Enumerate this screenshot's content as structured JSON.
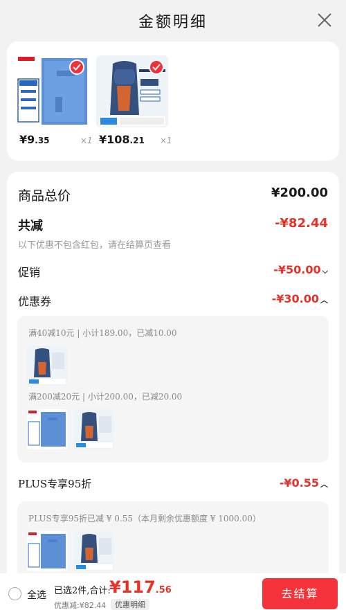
{
  "header": {
    "title": "金额明细"
  },
  "products": [
    {
      "price_int": "¥9",
      "price_dec": ".35",
      "qty": "×1",
      "image": "blue-file-box"
    },
    {
      "price_int": "¥108",
      "price_dec": ".21",
      "qty": "×1",
      "image": "blue-backpack"
    }
  ],
  "summary": {
    "total_label": "商品总价",
    "total_value": "¥200.00",
    "discount_label": "共减",
    "discount_value": "-¥82.44",
    "note": "以下优惠不包含红包，请在结算页查看",
    "promo_label": "促销",
    "promo_value": "-¥50.00",
    "coupon_label": "优惠券",
    "coupon_value": "-¥30.00",
    "coupon_details": [
      {
        "text": "满40减10元 | 小计189.00，已减10.00"
      },
      {
        "text": "满200减20元 | 小计200.00，已减20.00"
      }
    ],
    "plus_label": "PLUS专享95折",
    "plus_value": "-¥0.55",
    "plus_detail": "PLUS专享95折已减 ¥ 0.55（本月剩余优惠额度 ¥ 1000.00）"
  },
  "bottom_bar": {
    "select_all": "全选",
    "selected_text": "已选2件,合计:",
    "total_int": "¥117",
    "total_dec": ".56",
    "discount_text": "优惠减:¥82.44",
    "detail_button": "优惠明细",
    "checkout_button": "去结算"
  },
  "colors": {
    "accent": "#e63228",
    "checkout": "#f5333a"
  }
}
